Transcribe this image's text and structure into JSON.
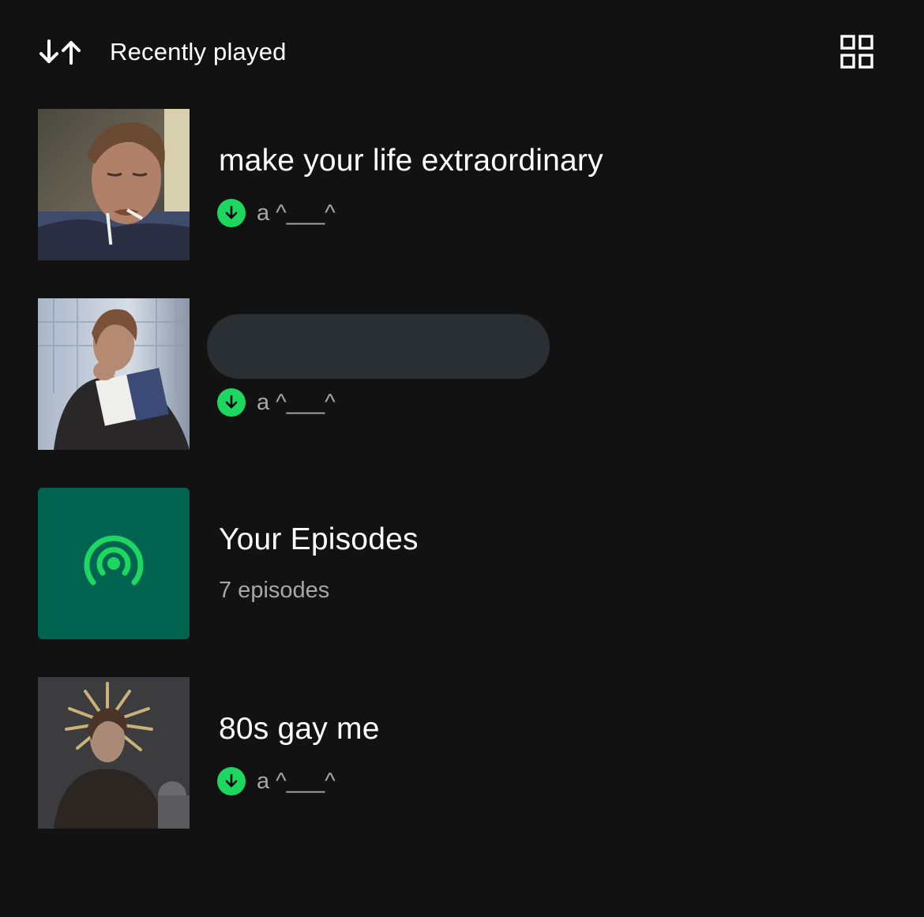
{
  "header": {
    "sort_icon": "sort-arrows-icon",
    "sort_label": "Recently played",
    "view_icon": "grid-view-icon"
  },
  "library": {
    "items": [
      {
        "title": "make your life extraordinary",
        "subtitle": "a ^___^",
        "downloaded": true,
        "artwork": "photo"
      },
      {
        "title": "",
        "title_redacted": true,
        "subtitle": "a ^___^",
        "downloaded": true,
        "artwork": "photo"
      },
      {
        "title": "Your Episodes",
        "subtitle": "7 episodes",
        "downloaded": false,
        "artwork": "podcast-icon"
      },
      {
        "title": "80s gay me",
        "subtitle": "a ^___^",
        "downloaded": true,
        "artwork": "photo"
      }
    ]
  },
  "colors": {
    "background": "#121212",
    "accent_green": "#1ed760",
    "episodes_tile": "#006450",
    "secondary_text": "#a7a7a7"
  }
}
